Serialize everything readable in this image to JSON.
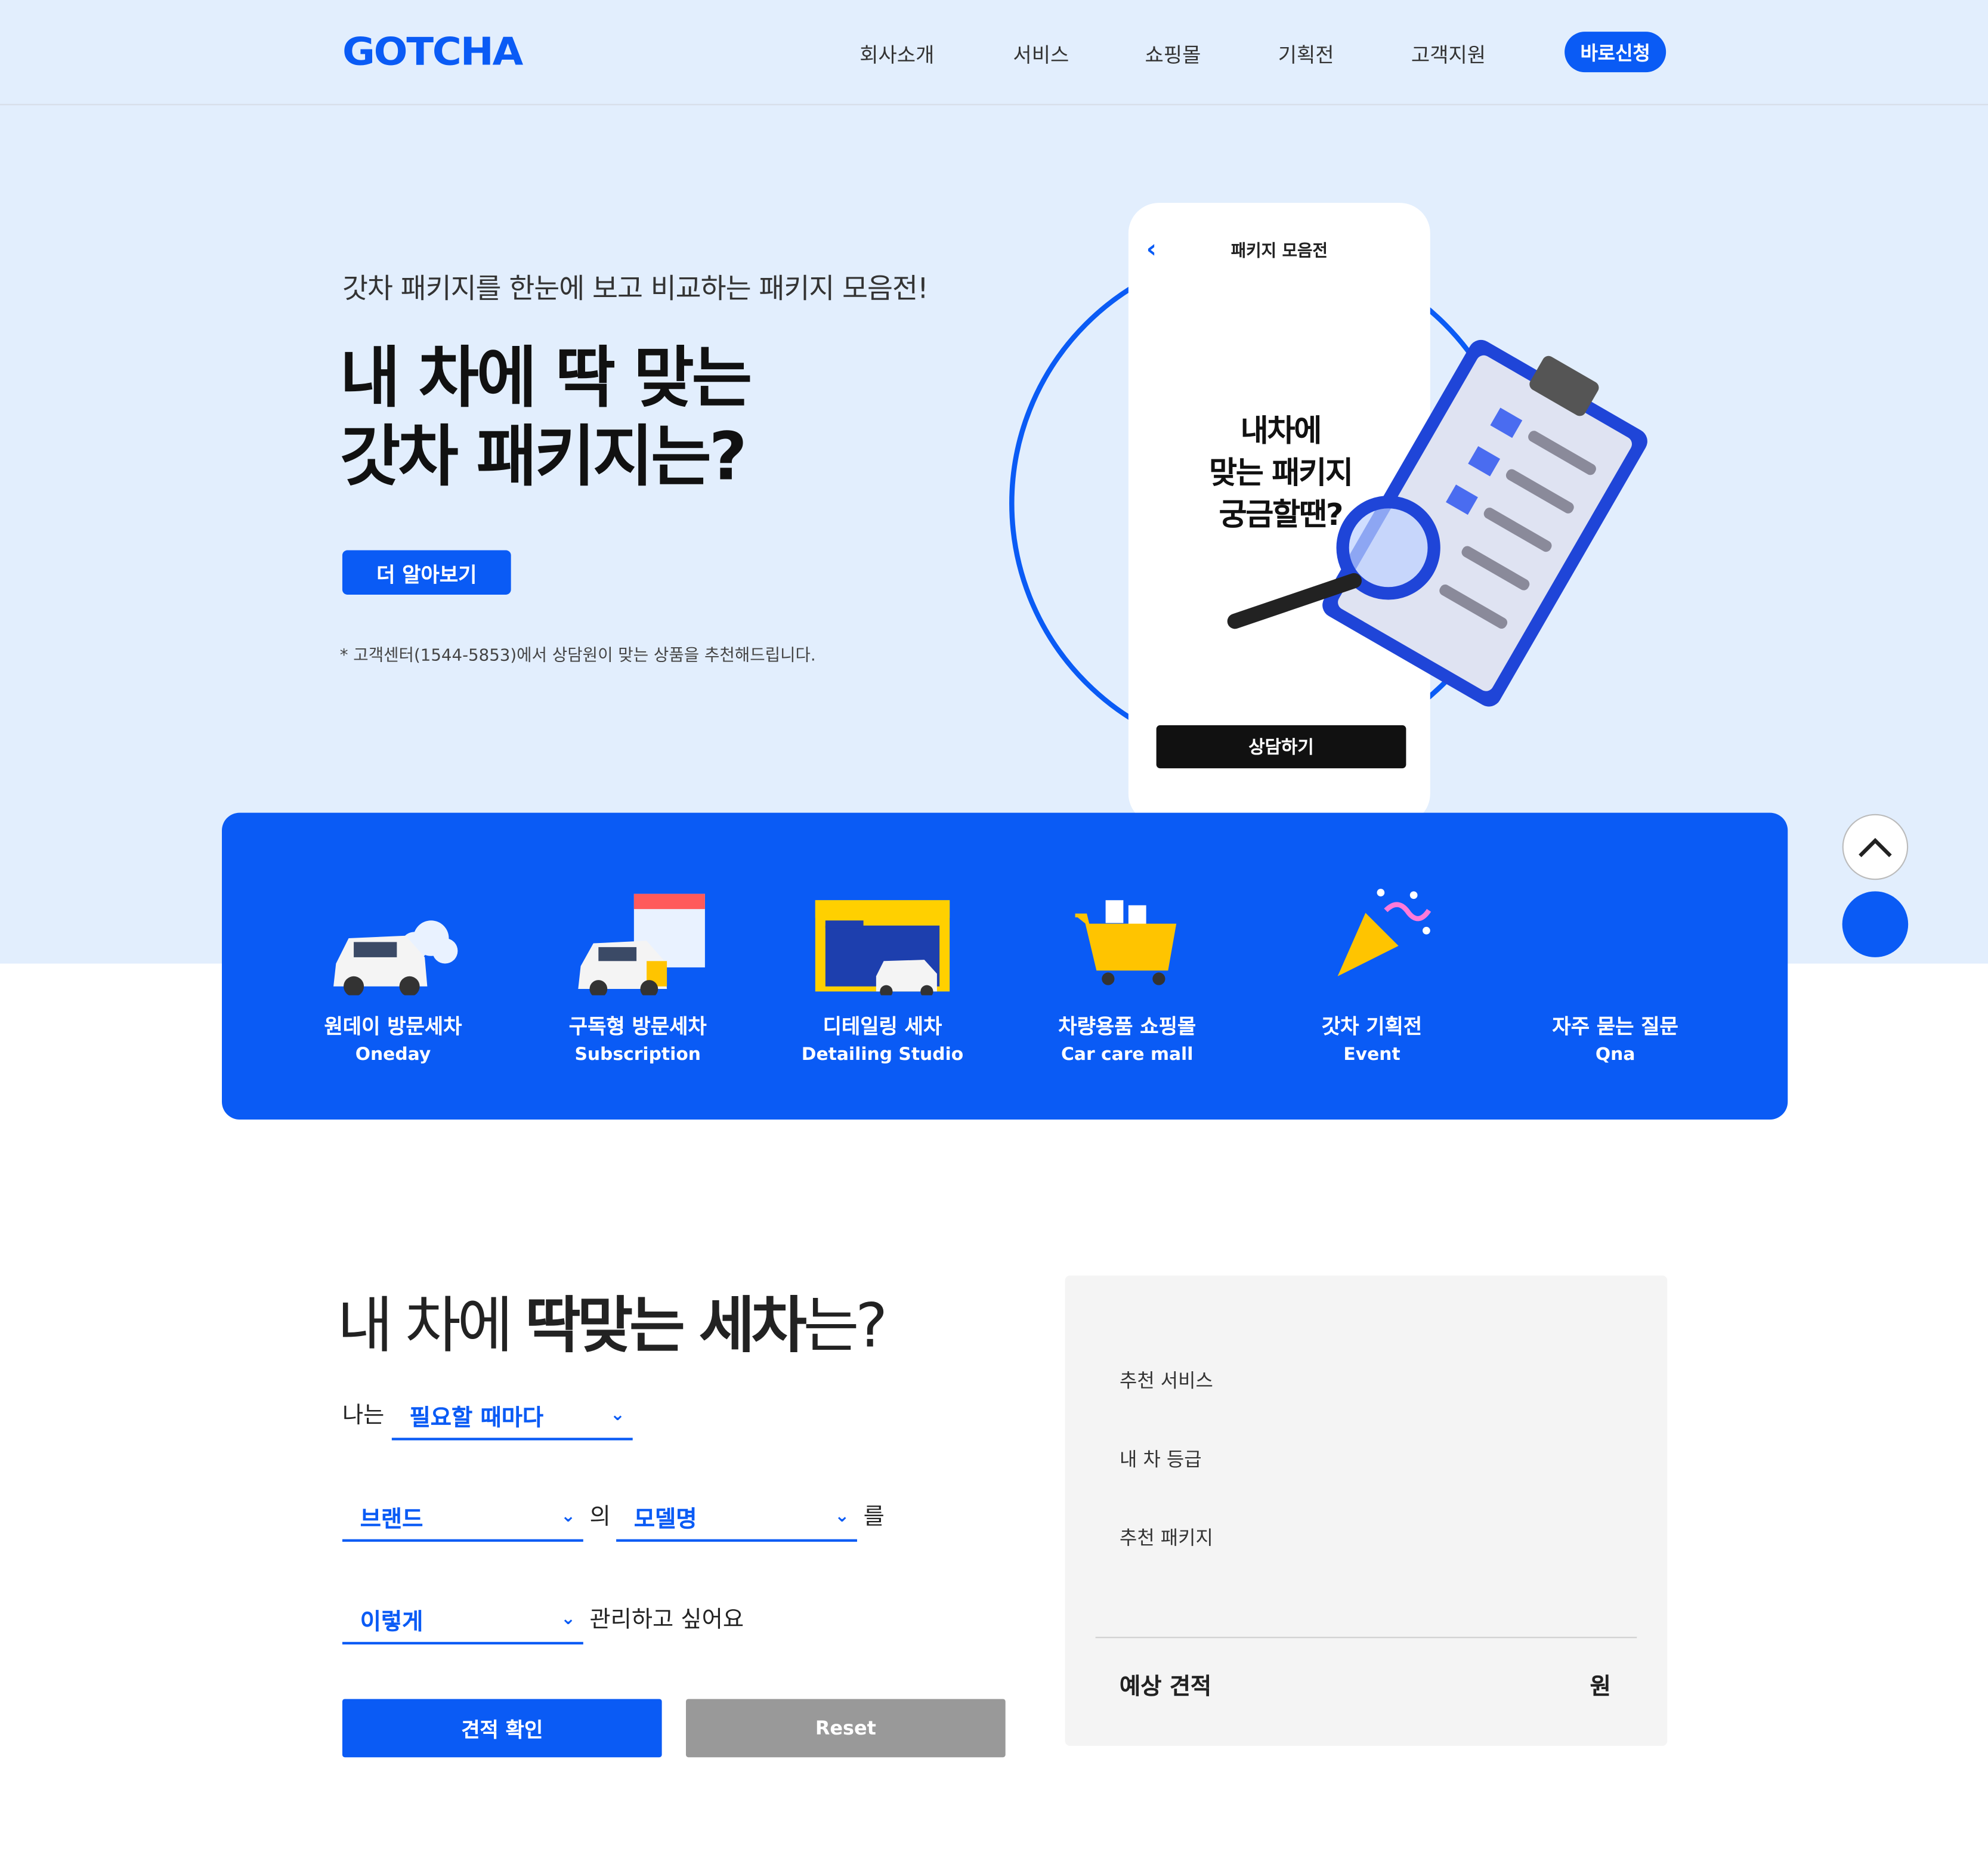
{
  "header": {
    "logo": "GOTCHA",
    "nav": [
      "회사소개",
      "서비스",
      "쇼핑몰",
      "기획전",
      "고객지원"
    ],
    "cta": "바로신청"
  },
  "hero": {
    "subtitle": "갓차 패키지를 한눈에 보고 비교하는 패키지 모음전!",
    "title_line1": "내 차에 딱 맞는",
    "title_line2": "갓차 패키지는?",
    "button": "더 알아보기",
    "note": "* 고객센터(1544-5853)에서 상담원이 맞는 상품을 추천해드립니다.",
    "phone": {
      "title": "패키지 모음전",
      "text_line1": "내차에",
      "text_line2": "맞는 패키지",
      "text_line3": "궁금할땐?",
      "button": "상담하기"
    }
  },
  "services": [
    {
      "ko": "원데이 방문세차",
      "en": "Oneday",
      "icon": "car-wash-icon"
    },
    {
      "ko": "구독형 방문세차",
      "en": "Subscription",
      "icon": "calendar-car-icon"
    },
    {
      "ko": "디테일링 세차",
      "en": "Detailing Studio",
      "icon": "studio-icon"
    },
    {
      "ko": "차량용품 쇼핑몰",
      "en": "Car care mall",
      "icon": "cart-icon"
    },
    {
      "ko": "갓차 기획전",
      "en": "Event",
      "icon": "party-popper-icon"
    },
    {
      "ko": "자주 묻는 질문",
      "en": "Qna",
      "icon": "faq-icon"
    }
  ],
  "estimator": {
    "title_light1": "내 차에 ",
    "title_bold1": "딱맞는 세차",
    "title_light2": "는?",
    "row1_prefix": "나는",
    "frequency": "필요할 때마다",
    "brand": "브랜드",
    "of": "의",
    "model": "모델명",
    "obj": "를",
    "how": "이렇게",
    "want": "관리하고 싶어요",
    "btn_quote": "견적 확인",
    "btn_reset": "Reset"
  },
  "result": {
    "service_label": "추천 서비스",
    "grade_label": "내 차 등급",
    "package_label": "추천 패키지",
    "total_label": "예상 견적",
    "currency": "원"
  },
  "colors": {
    "primary": "#0a5bf5",
    "hero_bg": "#e2eefd"
  }
}
